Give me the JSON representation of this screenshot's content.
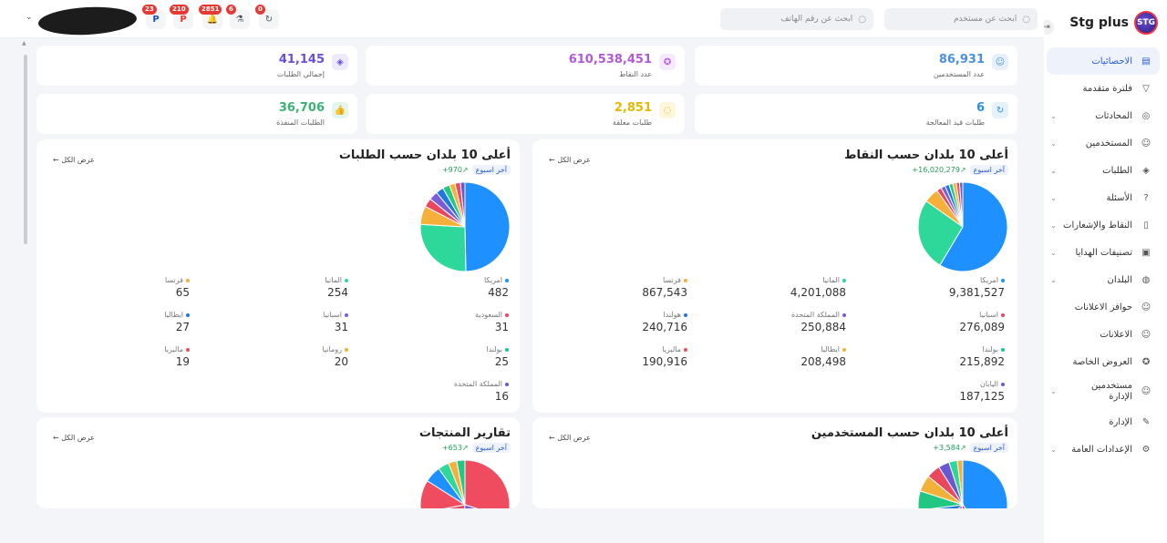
{
  "brand": {
    "name": "Stg plus",
    "logo_text": "STG"
  },
  "topbar": {
    "search_user_placeholder": "ابحث عن مستخدم",
    "search_phone_placeholder": "ابحث عن رقم الهاتف",
    "icons": [
      {
        "name": "refresh-icon",
        "badge": "0",
        "glyph": "↻"
      },
      {
        "name": "flask-icon",
        "badge": "6",
        "glyph": "⚗"
      },
      {
        "name": "bell-icon",
        "badge": "2851",
        "glyph": "🔔"
      },
      {
        "name": "paypal-red-icon",
        "badge": "210",
        "glyph": "P"
      },
      {
        "name": "paypal-blue-icon",
        "badge": "23",
        "glyph": "P"
      }
    ]
  },
  "sidebar": {
    "items": [
      {
        "label": "الاحصائيات",
        "icon": "chart-icon",
        "glyph": "▤",
        "active": true,
        "chevron": false
      },
      {
        "label": "فلترة متقدمة",
        "icon": "filter-icon",
        "glyph": "▽",
        "active": false,
        "chevron": false
      },
      {
        "label": "المحادثات",
        "icon": "chat-icon",
        "glyph": "◎",
        "active": false,
        "chevron": true
      },
      {
        "label": "المستخدمين",
        "icon": "users-icon",
        "glyph": "☺",
        "active": false,
        "chevron": true
      },
      {
        "label": "الطلبات",
        "icon": "box-icon",
        "glyph": "◈",
        "active": false,
        "chevron": true
      },
      {
        "label": "الأسئلة",
        "icon": "question-icon",
        "glyph": "?",
        "active": false,
        "chevron": true
      },
      {
        "label": "النقاط والإشعارات",
        "icon": "document-icon",
        "glyph": "▯",
        "active": false,
        "chevron": true
      },
      {
        "label": "تصنيفات الهدايا",
        "icon": "gift-icon",
        "glyph": "▣",
        "active": false,
        "chevron": true
      },
      {
        "label": "البلدان",
        "icon": "globe-icon",
        "glyph": "◍",
        "active": false,
        "chevron": true
      },
      {
        "label": "حوافز الاعلانات",
        "icon": "smile-icon",
        "glyph": "☺",
        "active": false,
        "chevron": false
      },
      {
        "label": "الاعلانات",
        "icon": "smile-icon",
        "glyph": "☺",
        "active": false,
        "chevron": false
      },
      {
        "label": "العروض الخاصة",
        "icon": "badge-icon",
        "glyph": "✪",
        "active": false,
        "chevron": false
      },
      {
        "label": "مستخدمين الإدارة",
        "icon": "admin-users-icon",
        "glyph": "☺",
        "active": false,
        "chevron": true,
        "two_line": true
      },
      {
        "label": "الإدارة",
        "icon": "admin-icon",
        "glyph": "✎",
        "active": false,
        "chevron": false
      },
      {
        "label": "الإعدادات العامة",
        "icon": "settings-icon",
        "glyph": "⚙",
        "active": false,
        "chevron": true
      }
    ]
  },
  "stats": [
    {
      "value": "86,931",
      "label": "عدد المستخدمين",
      "color": "#4a90e2",
      "bg": "#e7f1fc",
      "icon": "users-icon",
      "glyph": "☺"
    },
    {
      "value": "610,538,451",
      "label": "عدد النقاط",
      "color": "#b05ad6",
      "bg": "#f5e9fb",
      "icon": "award-icon",
      "glyph": "✪"
    },
    {
      "value": "41,145",
      "label": "إجمالي الطلبات",
      "color": "#6a4fd6",
      "bg": "#eeeafb",
      "icon": "box-icon",
      "glyph": "◈"
    },
    {
      "value": "6",
      "label": "طلبات قيد المعالجة",
      "color": "#2f8fdd",
      "bg": "#e5f1fb",
      "icon": "refresh-icon",
      "glyph": "↻"
    },
    {
      "value": "2,851",
      "label": "طلبات معلقة",
      "color": "#e6b800",
      "bg": "#fdf6dd",
      "icon": "pending-icon",
      "glyph": "◌"
    },
    {
      "value": "36,706",
      "label": "الطلبات المنفذة",
      "color": "#3bb273",
      "bg": "#e4f6ec",
      "icon": "thumbs-up-icon",
      "glyph": "👍"
    }
  ],
  "common": {
    "view_all": "عرض الكل",
    "period": "آخر اسبوع"
  },
  "cards": {
    "points": {
      "title": "أعلى 10 بلدان حسب النقاط",
      "delta": "16,020,279+"
    },
    "orders": {
      "title": "أعلى 10 بلدان حسب الطلبات",
      "delta": "970+"
    },
    "users": {
      "title": "أعلى 10 بلدان حسب المستخدمين",
      "delta": "3,584+"
    },
    "products": {
      "title": "تقارير المنتجات",
      "delta": "653+"
    }
  },
  "chart_data": [
    {
      "type": "pie",
      "title": "أعلى 10 بلدان حسب النقاط",
      "categories": [
        "امريكا",
        "المانيا",
        "فرنسا",
        "اسبانيا",
        "المملكة المتحدة",
        "هولندا",
        "بولندا",
        "ايطاليا",
        "ماليزيا",
        "اليابان"
      ],
      "values": [
        9381527,
        4201088,
        867543,
        276089,
        250884,
        240716,
        215892,
        208498,
        190916,
        187125
      ],
      "display": [
        "9,381,527",
        "4,201,088",
        "867,543",
        "276,089",
        "250,884",
        "240,716",
        "215,892",
        "208,498",
        "190,916",
        "187,125"
      ],
      "colors": [
        "#1e90ff",
        "#2ed89a",
        "#f6b03a",
        "#e8475e",
        "#7b5bd6",
        "#1e78e0",
        "#22c784",
        "#f2b23a",
        "#ef4c60",
        "#6b57d1"
      ]
    },
    {
      "type": "pie",
      "title": "أعلى 10 بلدان حسب الطلبات",
      "categories": [
        "امريكا",
        "المانيا",
        "فرنسا",
        "السعودية",
        "اسبانيا",
        "ايطاليا",
        "بولندا",
        "رومانيا",
        "ماليزيا",
        "المملكة المتحدة"
      ],
      "values": [
        482,
        254,
        65,
        31,
        31,
        27,
        25,
        20,
        19,
        16
      ],
      "display": [
        "482",
        "254",
        "65",
        "31",
        "31",
        "27",
        "25",
        "20",
        "19",
        "16"
      ],
      "colors": [
        "#1e90ff",
        "#2ed89a",
        "#f6b03a",
        "#e8475e",
        "#7b5bd6",
        "#1e78e0",
        "#22c784",
        "#f2b23a",
        "#ef4c60",
        "#6b57d1"
      ]
    },
    {
      "type": "pie",
      "title": "أعلى 10 بلدان حسب المستخدمين",
      "values": [
        40,
        14,
        10,
        9,
        7,
        6,
        5,
        4,
        3,
        2
      ],
      "colors": [
        "#1e90ff",
        "#ef4c60",
        "#7b5bd6",
        "#1e78e0",
        "#22c784",
        "#f2b23a",
        "#e8475e",
        "#6b57d1",
        "#2ed89a",
        "#f6b03a"
      ]
    },
    {
      "type": "pie",
      "title": "تقارير المنتجات",
      "values": [
        30,
        22,
        20,
        12,
        6,
        4,
        3,
        3
      ],
      "colors": [
        "#ef4c60",
        "#7b5bd6",
        "#e8475e",
        "#ef4c60",
        "#1e90ff",
        "#2ed89a",
        "#f6b03a",
        "#22c784"
      ]
    }
  ]
}
